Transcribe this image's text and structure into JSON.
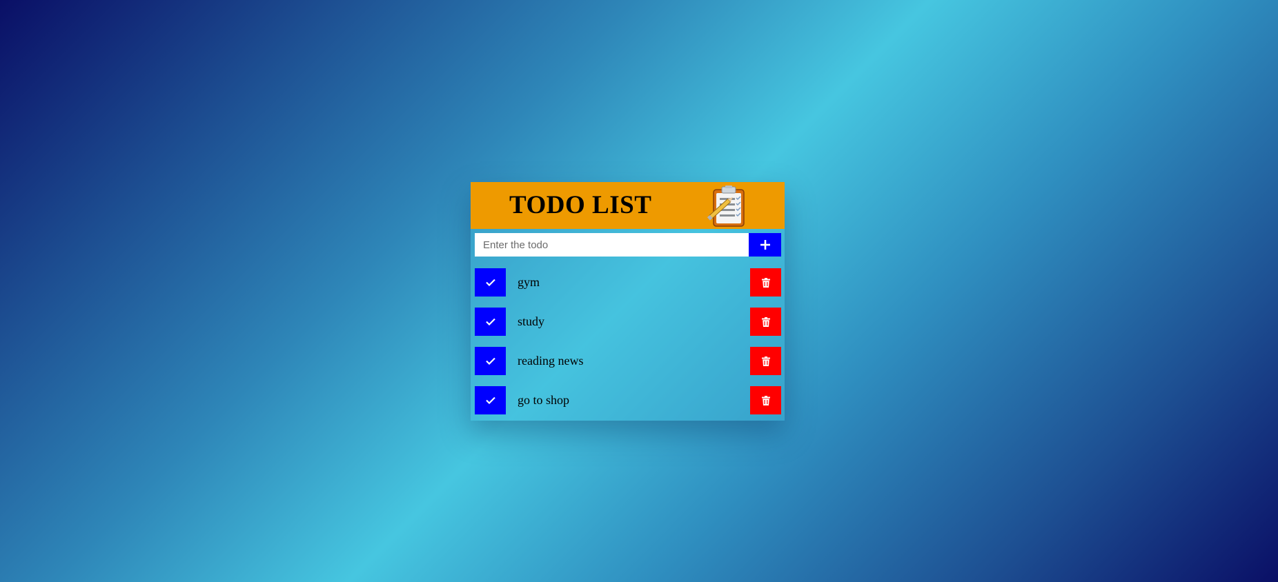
{
  "app": {
    "title": "TODO LIST",
    "header_color": "#ee9a00"
  },
  "input": {
    "placeholder": "Enter the todo",
    "value": "",
    "add_icon": "plus-icon"
  },
  "todos": [
    {
      "label": "gym",
      "check_icon": "check-icon",
      "delete_icon": "trash-icon"
    },
    {
      "label": "study",
      "check_icon": "check-icon",
      "delete_icon": "trash-icon"
    },
    {
      "label": "reading news",
      "check_icon": "check-icon",
      "delete_icon": "trash-icon"
    },
    {
      "label": "go to shop",
      "check_icon": "check-icon",
      "delete_icon": "trash-icon"
    }
  ],
  "colors": {
    "check_button": "#0000ff",
    "delete_button": "#ff0000",
    "add_button": "#0000ff"
  }
}
